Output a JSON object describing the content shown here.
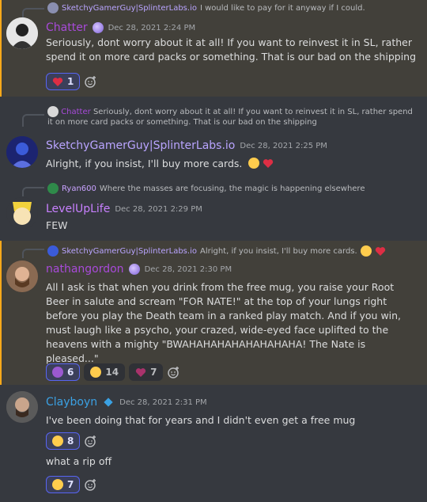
{
  "colors": {
    "background": "#36393f",
    "highlight": "#42403a",
    "mention_bar": "#faa81a",
    "reaction_active": "#5865f2"
  },
  "m1": {
    "reply_author": "SketchyGamerGuy|SplinterLabs.io",
    "reply_text": "I would like to pay for it anyway if I could.",
    "author": "Chatter",
    "timestamp": "Dec 28, 2021 2:24 PM",
    "text": "Seriously, dont worry about it at all! If you want to reinvest it in SL, rather spend it on more card packs or something. That is our bad on the shipping",
    "reactions": [
      {
        "emoji": "heart",
        "count": "1"
      }
    ]
  },
  "m2": {
    "reply_author": "Chatter",
    "reply_text": "Seriously, dont worry about it at all! If you want to reinvest it in SL, rather spend it on more card packs or something. That is our bad on the shipping",
    "author": "SketchyGamerGuy|SplinterLabs.io",
    "timestamp": "Dec 28, 2021 2:25 PM",
    "text": "Alright, if you insist, I'll buy more cards."
  },
  "m3": {
    "reply_author": "Ryan600",
    "reply_text": "Where the masses are focusing, the magic is happening elsewhere",
    "author": "LevelUpLife",
    "timestamp": "Dec 28, 2021 2:29 PM",
    "text": "FEW"
  },
  "m4": {
    "reply_author": "SketchyGamerGuy|SplinterLabs.io",
    "reply_text": "Alright, if you insist, I'll buy more cards.",
    "author": "nathangordon",
    "timestamp": "Dec 28, 2021 2:30 PM",
    "text": "All I ask is that when you drink from the free mug, you raise your Root Beer in salute and scream \"FOR NATE!\" at the top of your lungs right before you play the Death team in a ranked play match. And if you win, must laugh like a psycho, your crazed, wide-eyed face uplifted to the heavens with a mighty \"BWAHAHAHAHAHAHAHAHA! The Nate is pleased...\"",
    "reactions": [
      {
        "emoji": "purple-face",
        "count": "6"
      },
      {
        "emoji": "joy",
        "count": "14"
      },
      {
        "emoji": "heart-purple",
        "count": "7"
      }
    ]
  },
  "m5": {
    "author": "Clayboyn",
    "timestamp": "Dec 28, 2021 2:31 PM",
    "text": "I've been doing that for years and I didn't even get a free mug",
    "reactions": [
      {
        "emoji": "rofl",
        "count": "8"
      }
    ],
    "text2": "what a rip off",
    "reactions2": [
      {
        "emoji": "rofl",
        "count": "7"
      }
    ]
  }
}
